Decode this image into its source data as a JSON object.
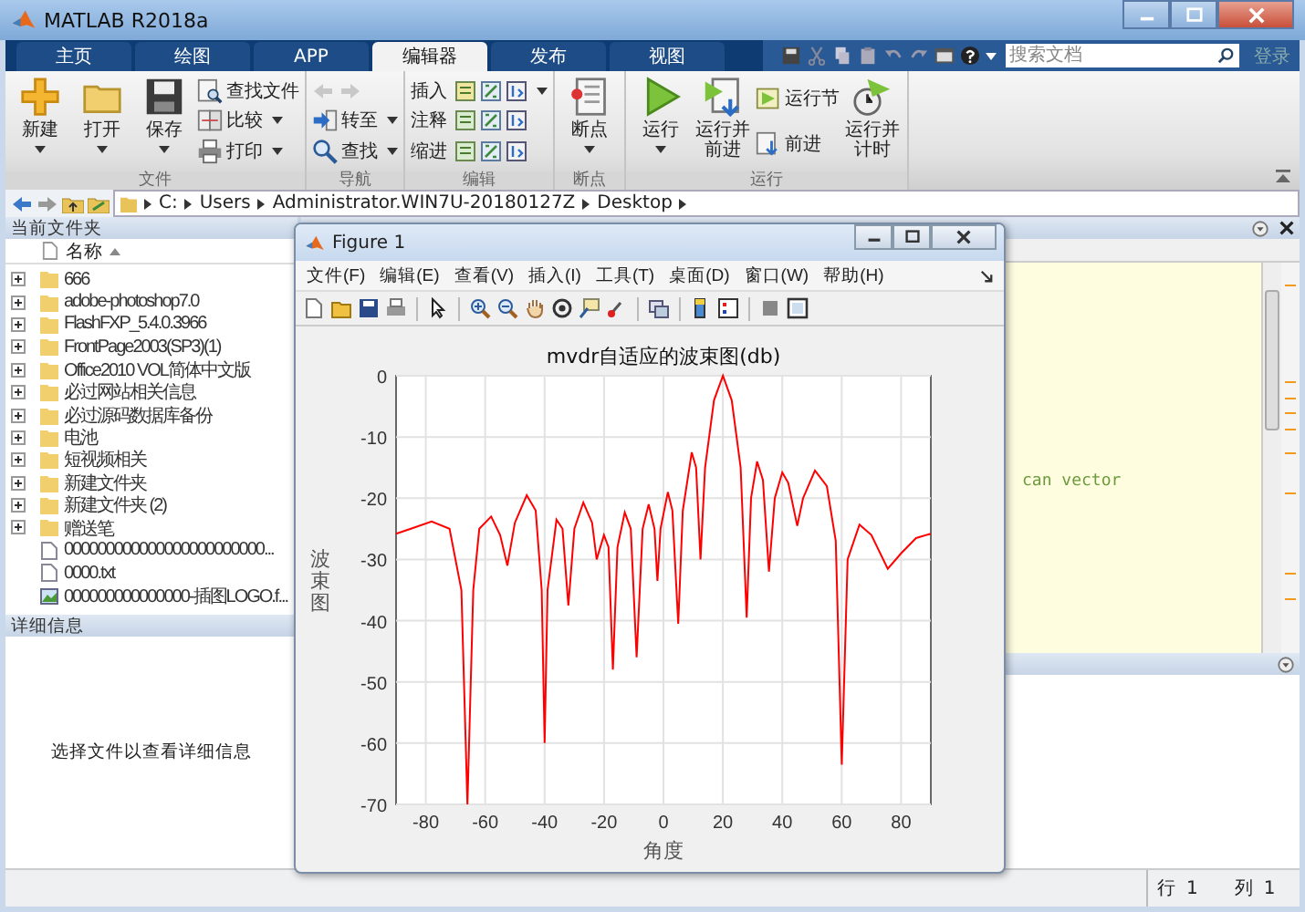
{
  "window": {
    "title": "MATLAB R2018a"
  },
  "tabs": [
    {
      "label": "主页",
      "selected": false
    },
    {
      "label": "绘图",
      "selected": false
    },
    {
      "label": "APP",
      "selected": false
    },
    {
      "label": "编辑器",
      "selected": true
    },
    {
      "label": "发布",
      "selected": false
    },
    {
      "label": "视图",
      "selected": false
    }
  ],
  "search": {
    "placeholder": "搜索文档"
  },
  "login": "登录",
  "ribbon": {
    "groups": [
      {
        "label": "文件",
        "columns": [
          {
            "kind": "large",
            "label": "新建",
            "dropdown": true
          },
          {
            "kind": "large",
            "label": "打开",
            "dropdown": true
          },
          {
            "kind": "large",
            "label": "保存",
            "dropdown": true
          },
          {
            "kind": "stack",
            "rows": [
              {
                "kind": "text",
                "label": "查找文件",
                "dropdown": false
              },
              {
                "kind": "text",
                "label": "比较",
                "dropdown": true
              },
              {
                "kind": "text",
                "label": "打印",
                "dropdown": true
              }
            ]
          }
        ]
      },
      {
        "label": "导航",
        "columns": [
          {
            "kind": "stack",
            "rows": [
              {
                "kind": "arrows",
                "disabled": true
              },
              {
                "kind": "text",
                "label": "转至",
                "dropdown": true
              },
              {
                "kind": "text",
                "label": "查找",
                "dropdown": true
              }
            ]
          }
        ]
      },
      {
        "label": "编辑",
        "columns": [
          {
            "kind": "stack",
            "rows": [
              {
                "kind": "edit",
                "label": "插入",
                "dropdown": true
              },
              {
                "kind": "edit",
                "label": "注释",
                "dropdown": false
              },
              {
                "kind": "edit",
                "label": "缩进",
                "dropdown": false
              }
            ]
          }
        ]
      },
      {
        "label": "断点",
        "columns": [
          {
            "kind": "large",
            "label": "断点",
            "dropdown": true
          }
        ]
      },
      {
        "label": "运行",
        "columns": [
          {
            "kind": "large",
            "label": "运行",
            "dropdown": true
          },
          {
            "kind": "large",
            "label": "运行并前进",
            "dropdown": false
          },
          {
            "kind": "stack",
            "rows": [
              {
                "kind": "text",
                "label": "运行节",
                "dropdown": false
              },
              {
                "kind": "text",
                "label": "前进",
                "dropdown": false
              }
            ]
          },
          {
            "kind": "large",
            "label": "运行并计时",
            "dropdown": false
          }
        ]
      }
    ]
  },
  "address_bar": {
    "path": [
      "C:",
      "Users",
      "Administrator.WIN7U-20180127Z",
      "Desktop"
    ]
  },
  "current_folder": {
    "title": "当前文件夹",
    "column": "名称",
    "items": [
      {
        "kind": "folder",
        "name": "666",
        "expanded": false
      },
      {
        "kind": "folder",
        "name": "adobe-photoshop7.0",
        "expanded": false
      },
      {
        "kind": "folder",
        "name": "FlashFXP_5.4.0.3966",
        "expanded": false
      },
      {
        "kind": "folder",
        "name": "FrontPage2003(SP3)(1)",
        "expanded": false
      },
      {
        "kind": "folder",
        "name": "Office2010 VOL简体中文版",
        "expanded": false
      },
      {
        "kind": "folder",
        "name": "必过网站相关信息",
        "expanded": false
      },
      {
        "kind": "folder",
        "name": "必过源码数据库备份",
        "expanded": false
      },
      {
        "kind": "folder",
        "name": "电池",
        "expanded": false
      },
      {
        "kind": "folder",
        "name": "短视频相关",
        "expanded": false
      },
      {
        "kind": "folder",
        "name": "新建文件夹",
        "expanded": false
      },
      {
        "kind": "folder",
        "name": "新建文件夹 (2)",
        "expanded": false
      },
      {
        "kind": "folder",
        "name": "赠送笔",
        "expanded": false
      },
      {
        "kind": "file",
        "name": "000000000000000000000000..."
      },
      {
        "kind": "file",
        "name": "0000.txt"
      },
      {
        "kind": "image",
        "name": "000000000000000-插图LOGO.f..."
      }
    ]
  },
  "details": {
    "title": "详细信息",
    "message": "选择文件以查看详细信息"
  },
  "editor": {
    "text": "can vector"
  },
  "figure": {
    "title": "Figure 1",
    "menus": [
      "文件(F)",
      "编辑(E)",
      "查看(V)",
      "插入(I)",
      "工具(T)",
      "桌面(D)",
      "窗口(W)",
      "帮助(H)"
    ],
    "chart_data": {
      "type": "line",
      "grid": true,
      "title": "mvdr自适应的波束图(db)",
      "xlabel": "角度",
      "ylabel": "波束图",
      "x": [
        -90,
        -85,
        -78,
        -72,
        -68,
        -66,
        -64,
        -62,
        -58,
        -55,
        -52.5,
        -50,
        -46,
        -43,
        -41,
        -40,
        -39,
        -36,
        -34,
        -32,
        -30,
        -27,
        -24,
        -22.5,
        -20,
        -18.5,
        -17,
        -15.5,
        -13,
        -11,
        -9,
        -7,
        -5,
        -3,
        -2,
        -1,
        1.5,
        3,
        5,
        6.5,
        9.5,
        11,
        12.5,
        14,
        17,
        20,
        23,
        26,
        28,
        29.5,
        31.5,
        33.5,
        35.5,
        37.5,
        40,
        42,
        45,
        47,
        51,
        55,
        58,
        60,
        62,
        66,
        70,
        75.5,
        80,
        85,
        90
      ],
      "series": [
        {
          "color": "#ff0000",
          "values": [
            -25.8,
            -25,
            -23.8,
            -25,
            -35,
            -70,
            -35,
            -25,
            -23,
            -26,
            -31,
            -24,
            -19.5,
            -22,
            -35,
            -60,
            -35,
            -23.5,
            -25,
            -37.5,
            -25,
            -20.7,
            -24,
            -30,
            -26,
            -28,
            -48,
            -28,
            -22.3,
            -25,
            -46,
            -25,
            -21,
            -25,
            -33.5,
            -25,
            -19,
            -22,
            -40.5,
            -22,
            -12.5,
            -15,
            -30,
            -15,
            -4,
            0,
            -4,
            -15,
            -39.5,
            -20,
            -14,
            -17,
            -32,
            -20,
            -15.8,
            -17.5,
            -24.5,
            -20,
            -15.5,
            -18,
            -27,
            -63.5,
            -30,
            -24.3,
            -26,
            -31.5,
            -29,
            -26.5,
            -25.8
          ]
        }
      ],
      "xlim": [
        -90,
        90
      ],
      "ylim": [
        -70,
        0
      ],
      "xticks": [
        -80,
        -60,
        -40,
        -20,
        0,
        20,
        40,
        60,
        80
      ],
      "yticks": [
        0,
        -10,
        -20,
        -30,
        -40,
        -50,
        -60,
        -70
      ]
    }
  },
  "status_bar": {
    "row_label": "行",
    "row": "1",
    "col_label": "列",
    "col": "1"
  }
}
